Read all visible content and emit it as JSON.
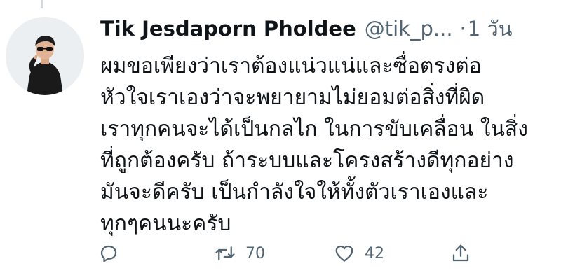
{
  "tweet": {
    "display_name": "Tik Jesdaporn Pholdee",
    "handle": "@tik_p...",
    "separator": "·",
    "time": "1 วัน",
    "text_lines": [
      "ผมขอเพียงว่าเราต้องแน่วแน่และซื่อตรงต่อ",
      "หัวใจเราเองว่าจะพยายามไม่ยอมต่อสิ่งที่ผิด",
      "เราทุกคนจะได้เป็นกลไก ในการขับเคลื่อน ในสิ่ง",
      "ที่ถูกต้องครับ ถ้าระบบและโครงสร้างดีทุกอย่าง",
      "มันจะดีครับ เป็นกำลังใจให้ทั้งตัวเราเองและ",
      "ทุกๆคนนะครับ"
    ]
  },
  "actions": {
    "reply": {
      "icon": "reply-icon"
    },
    "retweet": {
      "icon": "retweet-icon",
      "count": "70"
    },
    "like": {
      "icon": "heart-icon",
      "count": "42"
    },
    "share": {
      "icon": "share-icon"
    }
  },
  "colors": {
    "text": "#0f1419",
    "secondary": "#536471",
    "thread_line": "#cfd9de"
  }
}
